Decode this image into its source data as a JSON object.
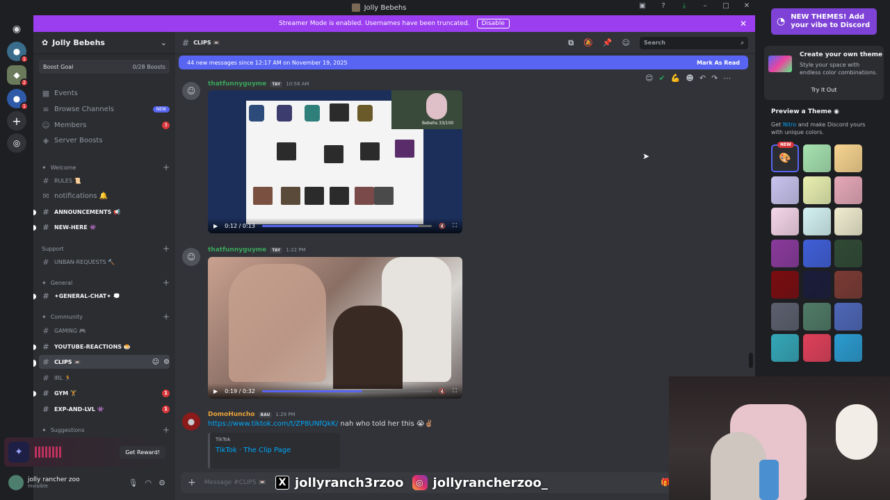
{
  "window": {
    "title": "Jolly Bebehs"
  },
  "banner": {
    "text": "Streamer Mode is enabled. Usernames have been truncated.",
    "button": "Disable"
  },
  "guilds": {
    "badges": [
      "1",
      "2",
      "1"
    ]
  },
  "server": {
    "name": "Jolly Bebehs",
    "boost_label": "Boost Goal",
    "boost_count": "0/28 Boosts"
  },
  "nav": {
    "events": "Events",
    "browse": "Browse Channels",
    "browse_badge": "NEW",
    "members": "Members",
    "members_badge": "3",
    "boosts": "Server Boosts"
  },
  "categories": {
    "welcome": "Welcome",
    "support": "Support",
    "general": "General",
    "community": "Community",
    "suggestions": "Suggestions"
  },
  "channels": {
    "rules": "RULES 📜",
    "notifications": "notifications 🔔",
    "announcements": "ANNOUNCEMENTS 📢",
    "new_here": "NEW-HERE 👾",
    "unban": "UNBAN-REQUESTS 🔨",
    "general_chat": "✦GENERAL-CHAT✦ 💭",
    "gaming": "GAMING 🎮",
    "youtube": "YOUTUBE-REACTIONS 🍮",
    "clips": "CLIPS 📼",
    "irl": "IRL 🏃",
    "gym": "GYM 🏋",
    "gym_badge": "1",
    "exp": "EXP-AND-LVL 👾",
    "exp_badge": "1"
  },
  "reward": {
    "button": "Get Reward!"
  },
  "user": {
    "name": "jolly rancher zoo",
    "status": "Invisible"
  },
  "header": {
    "channel": "CLIPS 📼",
    "search_placeholder": "Search"
  },
  "newbar": {
    "text": "44 new messages since 12:17 AM on November 19, 2025",
    "action": "Mark As Read"
  },
  "messages": [
    {
      "author": "thatfunnyguyme",
      "tag": "TAY",
      "time": "10:58 AM",
      "video_time": "0:12 / 0:13",
      "progress": 0.92,
      "overlay": "Bebehs 33/100"
    },
    {
      "author": "thatfunnyguyme",
      "tag": "TAY",
      "time": "1:22 PM",
      "video_time": "0:19 / 0:32",
      "progress": 0.59
    },
    {
      "author": "DomoHuncho",
      "tag": "BAU",
      "time": "1:29 PM",
      "link": "https://www.tiktok.com/t/ZP8UNfQkK/",
      "text": "nah who told her this 😭✌🏽",
      "embed_provider": "TikTok",
      "embed_title": "TikTok · The Clip Page"
    }
  ],
  "composer": {
    "placeholder": "Message #CLIPS 📼"
  },
  "socials": {
    "x": "jollyranch3rzoo",
    "ig": "jollyrancherzoo_"
  },
  "themes": {
    "promo": "NEW THEMES! Add your vibe to Discord",
    "card_title": "Create your own theme",
    "card_sub": "Style your space with endless color combinations.",
    "card_button": "Try It Out",
    "preview_title": "Preview a Theme",
    "preview_pre": "Get",
    "preview_nitro": "Nitro",
    "preview_post": "and make Discord yours with unique colors.",
    "new_tag": "NEW",
    "swatches": [
      "#a6e3b0",
      "#f7d48f",
      "#c9c3ef",
      "#e9f0b0",
      "#e6a8b8",
      "#f6d6ea",
      "#d4f2f3",
      "#efeccf",
      "#8a3a9c",
      "#3f5fd8",
      "#2f4a35",
      "#7a0c10",
      "#1a1c3a",
      "#7a3a33",
      "#5c5f6e",
      "#4f7a66",
      "#4d67b8",
      "#34a7b8",
      "#e0405a",
      "#2a9bd0"
    ],
    "accent": "#7e43d6"
  }
}
